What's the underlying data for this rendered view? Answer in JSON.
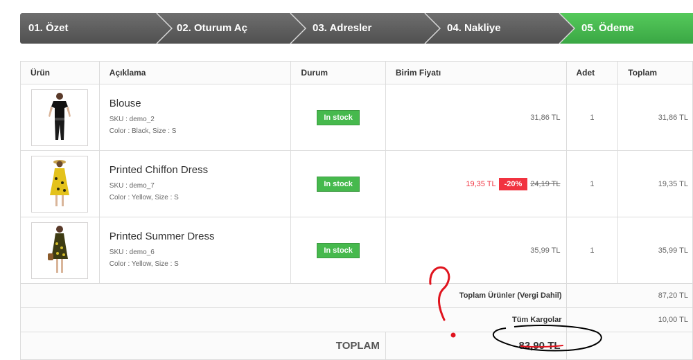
{
  "steps": [
    "01. Özet",
    "02. Oturum Aç",
    "03. Adresler",
    "04. Nakliye",
    "05. Ödeme"
  ],
  "columns": {
    "product": "Ürün",
    "description": "Açıklama",
    "status": "Durum",
    "unit_price": "Birim Fiyatı",
    "qty": "Adet",
    "total": "Toplam"
  },
  "items": [
    {
      "name": "Blouse",
      "sku": "SKU : demo_2",
      "attrs": "Color : Black, Size : S",
      "status": "In stock",
      "price": "31,86 TL",
      "qty": "1",
      "total": "31,86 TL"
    },
    {
      "name": "Printed Chiffon Dress",
      "sku": "SKU : demo_7",
      "attrs": "Color : Yellow, Size : S",
      "status": "In stock",
      "price_new": "19,35 TL",
      "discount": "-20%",
      "price_old": "24,19 TL",
      "qty": "1",
      "total": "19,35 TL"
    },
    {
      "name": "Printed Summer Dress",
      "sku": "SKU : demo_6",
      "attrs": "Color : Yellow, Size : S",
      "status": "In stock",
      "price": "35,99 TL",
      "qty": "1",
      "total": "35,99 TL"
    }
  ],
  "summary": {
    "products_label": "Toplam Ürünler (Vergi Dahil)",
    "products_value": "87,20 TL",
    "shipping_label": "Tüm Kargolar",
    "shipping_value": "10,00 TL",
    "grand_label": "TOPLAM",
    "grand_value": "83,90 TL"
  },
  "colors": {
    "step_inactive": "#5e5e5e",
    "step_active": "#46b94d",
    "in_stock": "#46b94d",
    "discount": "#f13340",
    "annotation_red": "#e0141e",
    "annotation_black": "#000000"
  }
}
